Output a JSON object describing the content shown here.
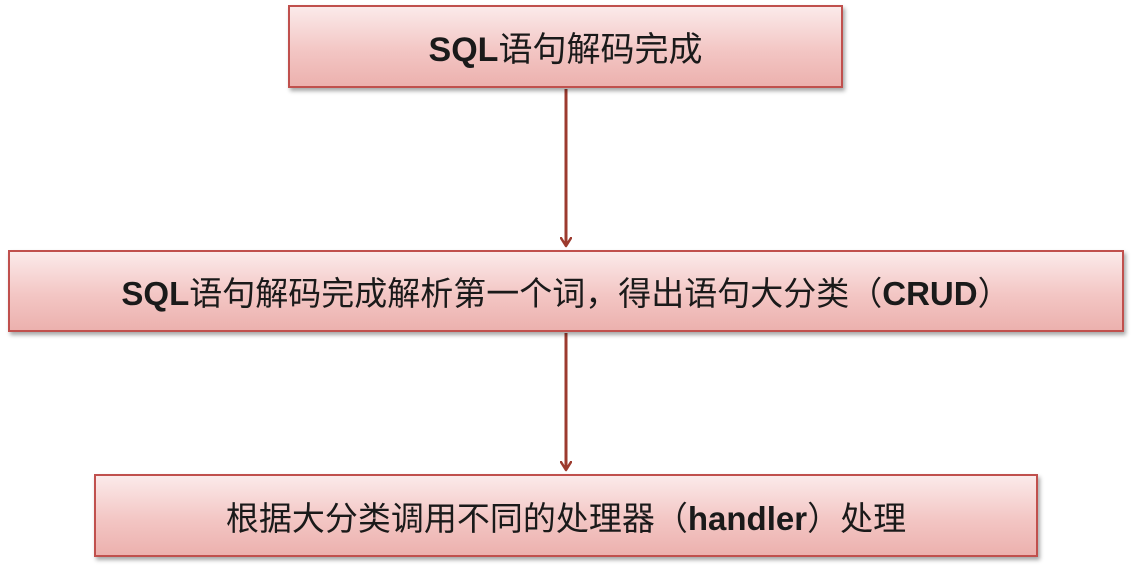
{
  "nodes": [
    {
      "id": "box1",
      "segments": [
        {
          "text": "SQL",
          "bold": true
        },
        {
          "text": "语句解码完成",
          "bold": false
        }
      ]
    },
    {
      "id": "box2",
      "segments": [
        {
          "text": "SQL",
          "bold": true
        },
        {
          "text": "语句解码完成解析第一个词，得出语句大分类（",
          "bold": false
        },
        {
          "text": "CRUD",
          "bold": true
        },
        {
          "text": "）",
          "bold": false
        }
      ]
    },
    {
      "id": "box3",
      "segments": [
        {
          "text": "根据大分类调用不同的处理器（",
          "bold": false
        },
        {
          "text": "handler",
          "bold": true
        },
        {
          "text": "）处理",
          "bold": false
        }
      ]
    }
  ],
  "edges": [
    {
      "from": "box1",
      "to": "box2"
    },
    {
      "from": "box2",
      "to": "box3"
    }
  ],
  "colors": {
    "box_border": "#c0504d",
    "box_fill_top": "#fbeaea",
    "box_fill_bottom": "#ecb1ae",
    "arrow": "#9c3a2e",
    "text": "#1a1a1a"
  }
}
